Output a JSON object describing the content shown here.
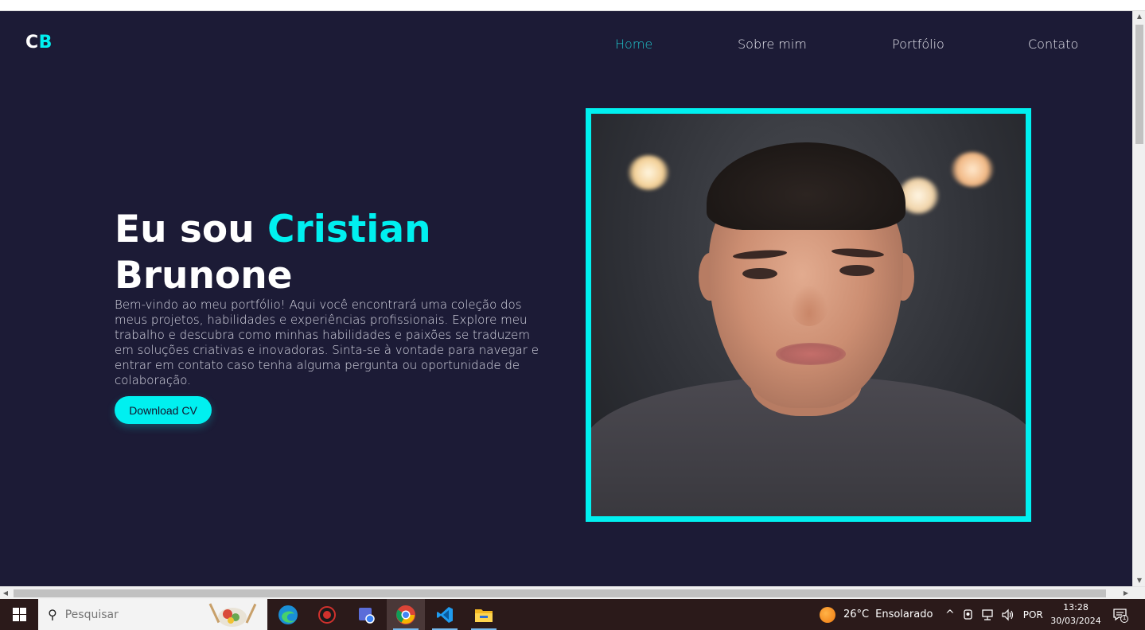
{
  "site": {
    "logo": {
      "first": "C",
      "second": "B"
    },
    "nav": [
      {
        "label": "Home",
        "active": true
      },
      {
        "label": "Sobre mim",
        "active": false
      },
      {
        "label": "Portfólio",
        "active": false
      },
      {
        "label": "Contato",
        "active": false
      }
    ],
    "hero": {
      "title_prefix": "Eu sou ",
      "title_accent": "Cristian",
      "title_rest": "Brunone",
      "description": "Bem-vindo ao meu portfólio! Aqui você encontrará uma coleção dos meus projetos, habilidades e experiências profissionais. Explore meu trabalho e descubra como minhas habilidades e paixões se traduzem em soluções criativas e inovadoras. Sinta-se à vontade para navegar e entrar em contato caso tenha alguma pergunta ou oportunidade de colaboração.",
      "cta_label": "Download CV"
    },
    "colors": {
      "background": "#1c1b36",
      "accent": "#00f0f0",
      "nav_active": "#20c5cc"
    }
  },
  "taskbar": {
    "search_placeholder": "Pesquisar",
    "weather": {
      "temp": "26°C",
      "condition": "Ensolarado"
    },
    "language": "POR",
    "time": "13:28",
    "date": "30/03/2024",
    "notification_count": "1",
    "apps": [
      "edge-icon",
      "shield-app-icon",
      "remote-app-icon",
      "chrome-icon",
      "vscode-icon",
      "file-explorer-icon"
    ]
  }
}
